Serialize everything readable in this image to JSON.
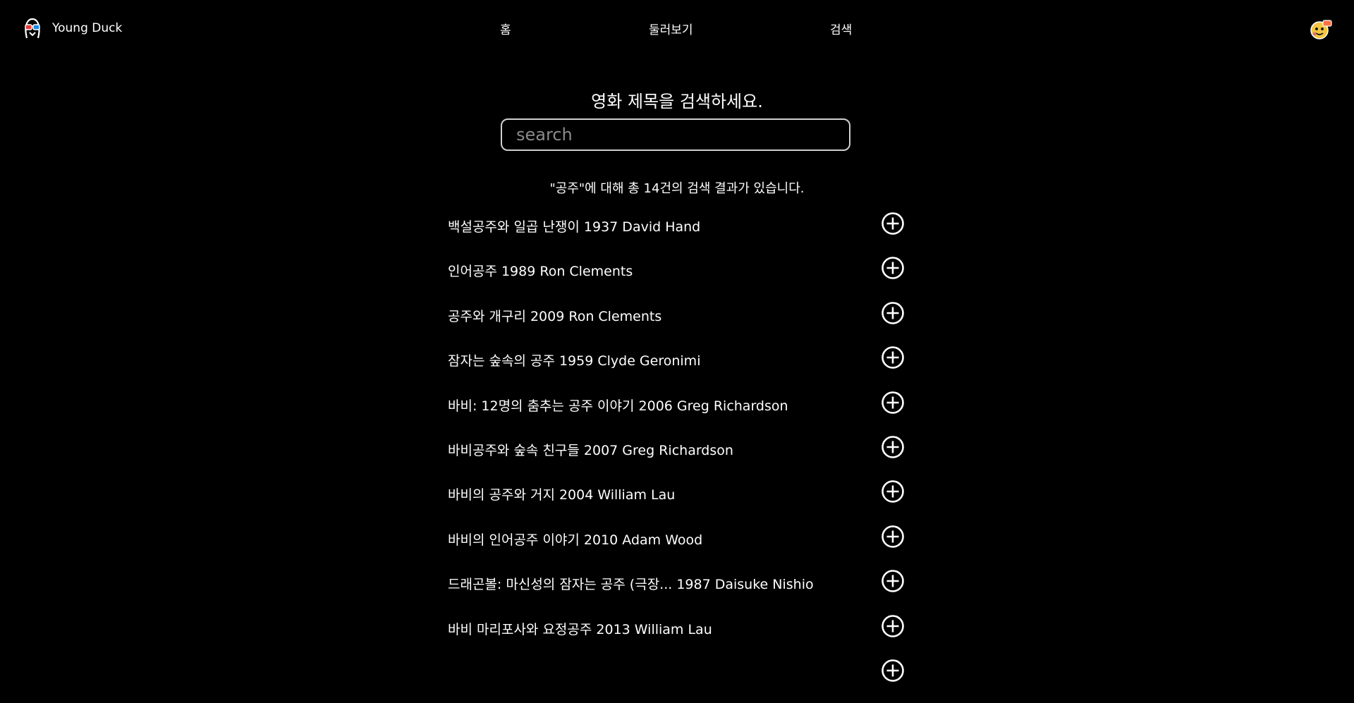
{
  "header": {
    "brand_icon": "duck-3d-glasses-icon",
    "brand_name": "Young Duck",
    "nav": [
      {
        "label": "홈"
      },
      {
        "label": "둘러보기"
      },
      {
        "label": "검색"
      }
    ],
    "avatar_icon": "user-avatar-icon"
  },
  "search": {
    "title": "영화 제목을 검색하세요.",
    "placeholder": "search",
    "value": "",
    "result_summary": "\"공주\"에 대해 총 14건의 검색 결과가 있습니다."
  },
  "results": [
    {
      "text": "백설공주와 일곱 난쟁이 1937 David Hand",
      "action_icon": "plus-circle-icon"
    },
    {
      "text": "인어공주 1989 Ron Clements",
      "action_icon": "plus-circle-icon"
    },
    {
      "text": "공주와 개구리 2009 Ron Clements",
      "action_icon": "plus-circle-icon"
    },
    {
      "text": "잠자는 숲속의 공주 1959 Clyde Geronimi",
      "action_icon": "plus-circle-icon"
    },
    {
      "text": "바비: 12명의 춤추는 공주 이야기 2006 Greg Richardson",
      "action_icon": "plus-circle-icon"
    },
    {
      "text": "바비공주와 숲속 친구들 2007 Greg Richardson",
      "action_icon": "plus-circle-icon"
    },
    {
      "text": "바비의 공주와 거지 2004 William Lau",
      "action_icon": "plus-circle-icon"
    },
    {
      "text": "바비의 인어공주 이야기 2010 Adam Wood",
      "action_icon": "plus-circle-icon"
    },
    {
      "text": "드래곤볼: 마신성의 잠자는 공주 (극장... 1987 Daisuke Nishio",
      "action_icon": "plus-circle-icon"
    },
    {
      "text": "바비 마리포사와 요정공주 2013 William Lau",
      "action_icon": "plus-circle-icon"
    },
    {
      "text": "",
      "action_icon": "plus-circle-icon"
    }
  ],
  "colors": {
    "background": "#000000",
    "text": "#ffffff",
    "search_border": "#cfcfcf",
    "placeholder": "#8a8a8a"
  }
}
